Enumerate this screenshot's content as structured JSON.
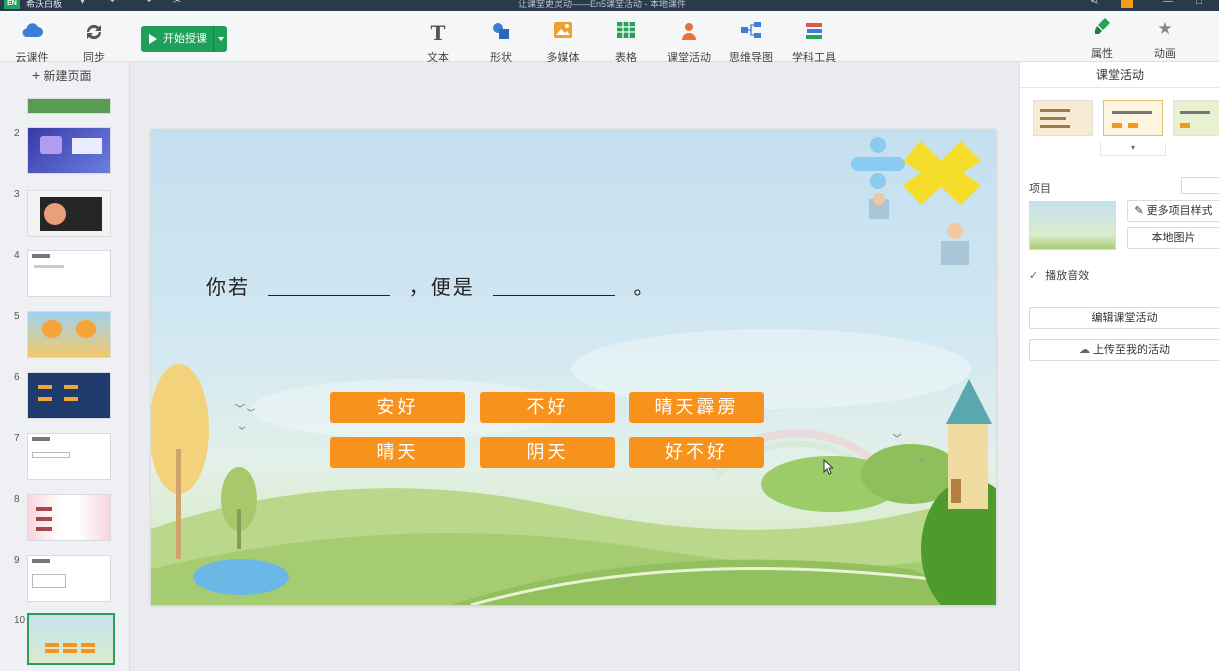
{
  "app": {
    "name": "希沃白板",
    "logo_text": "EN",
    "document_title": "让课堂更灵动——En5课堂活动 - 本地课件"
  },
  "toolbar": {
    "cloud_label": "云课件",
    "sync_label": "同步",
    "start_label": "开始授课",
    "tools": [
      {
        "label": "文本",
        "icon": "text-icon"
      },
      {
        "label": "形状",
        "icon": "shape-icon"
      },
      {
        "label": "多媒体",
        "icon": "image-icon"
      },
      {
        "label": "表格",
        "icon": "table-icon"
      },
      {
        "label": "课堂活动",
        "icon": "activity-icon"
      },
      {
        "label": "思维导图",
        "icon": "mindmap-icon"
      },
      {
        "label": "学科工具",
        "icon": "books-icon"
      }
    ],
    "props_label": "属性",
    "anim_label": "动画",
    "accent": "#1fa05a"
  },
  "slides_panel": {
    "new_page_label": "新建页面",
    "slides": [
      "2",
      "3",
      "4",
      "5",
      "6",
      "7",
      "8",
      "9",
      "10"
    ],
    "active": "10"
  },
  "slide": {
    "sentence_part1": "你若",
    "sentence_part2": "，便是",
    "sentence_end": "。",
    "options": [
      "安好",
      "不好",
      "晴天霹雳",
      "晴天",
      "阴天",
      "好不好"
    ],
    "option_color": "#f7921c"
  },
  "right_panel": {
    "title": "课堂活动",
    "items_label": "项目",
    "more_styles_label": "更多项目样式",
    "local_image_label": "本地图片",
    "play_sound_label": "播放音效",
    "play_sound_checked": true,
    "edit_activity_label": "编辑课堂活动",
    "upload_label": "上传至我的活动"
  }
}
